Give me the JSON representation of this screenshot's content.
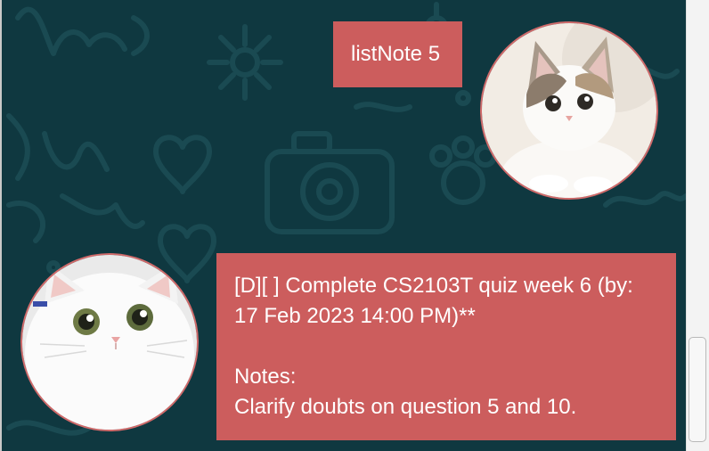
{
  "chat": {
    "user_message": "listNote 5",
    "bot_message": "[D][ ] Complete CS2103T quiz week 6 (by: 17 Feb 2023 14:00 PM)**\n\nNotes:\nClarify doubts on question 5 and 10.",
    "bubble_color": "#cc5d5d",
    "background_color": "#0f3840"
  },
  "avatars": {
    "user": "cat-avatar-icon",
    "bot": "cat-avatar-icon"
  }
}
